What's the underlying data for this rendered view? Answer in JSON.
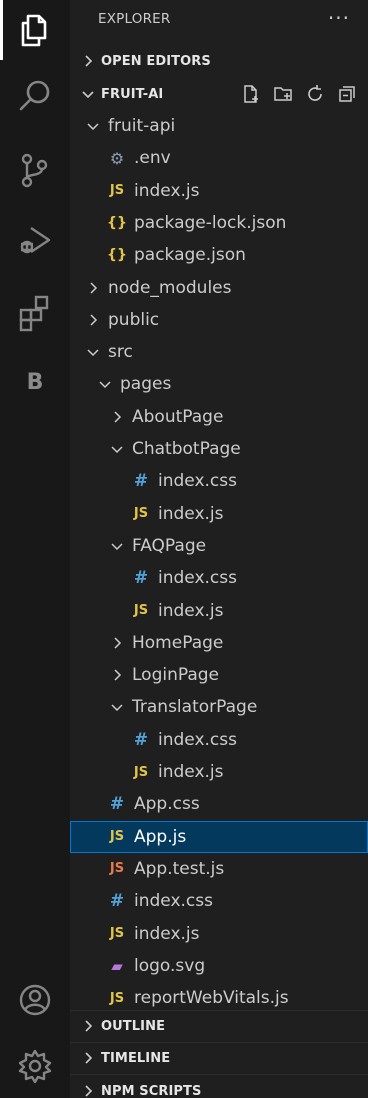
{
  "activity_bar": {
    "items": [
      {
        "name": "explorer-icon"
      },
      {
        "name": "search-icon"
      },
      {
        "name": "source-control-icon"
      },
      {
        "name": "run-debug-icon"
      },
      {
        "name": "extensions-icon"
      },
      {
        "name": "b-extension-icon",
        "label": "B"
      }
    ],
    "bottom": [
      {
        "name": "account-icon"
      },
      {
        "name": "settings-gear-icon"
      }
    ]
  },
  "explorer": {
    "title": "EXPLORER",
    "more": "···",
    "open_editors": "OPEN EDITORS",
    "project": "FRUIT-AI",
    "outline": "OUTLINE",
    "timeline": "TIMELINE",
    "npm_scripts": "NPM SCRIPTS"
  },
  "tree": [
    {
      "label": "fruit-api",
      "type": "folder",
      "expanded": true
    },
    {
      "label": ".env",
      "type": "env"
    },
    {
      "label": "index.js",
      "type": "js"
    },
    {
      "label": "package-lock.json",
      "type": "json"
    },
    {
      "label": "package.json",
      "type": "json"
    },
    {
      "label": "node_modules",
      "type": "folder",
      "expanded": false
    },
    {
      "label": "public",
      "type": "folder",
      "expanded": false
    },
    {
      "label": "src",
      "type": "folder",
      "expanded": true
    },
    {
      "label": "pages",
      "type": "folder",
      "expanded": true
    },
    {
      "label": "AboutPage",
      "type": "folder",
      "expanded": false
    },
    {
      "label": "ChatbotPage",
      "type": "folder",
      "expanded": true
    },
    {
      "label": "index.css",
      "type": "css"
    },
    {
      "label": "index.js",
      "type": "js"
    },
    {
      "label": "FAQPage",
      "type": "folder",
      "expanded": true
    },
    {
      "label": "index.css",
      "type": "css"
    },
    {
      "label": "index.js",
      "type": "js"
    },
    {
      "label": "HomePage",
      "type": "folder",
      "expanded": false
    },
    {
      "label": "LoginPage",
      "type": "folder",
      "expanded": false
    },
    {
      "label": "TranslatorPage",
      "type": "folder",
      "expanded": true
    },
    {
      "label": "index.css",
      "type": "css"
    },
    {
      "label": "index.js",
      "type": "js"
    },
    {
      "label": "App.css",
      "type": "css"
    },
    {
      "label": "App.js",
      "type": "js",
      "selected": true
    },
    {
      "label": "App.test.js",
      "type": "js-test"
    },
    {
      "label": "index.css",
      "type": "css"
    },
    {
      "label": "index.js",
      "type": "js"
    },
    {
      "label": "logo.svg",
      "type": "svg"
    },
    {
      "label": "reportWebVitals.js",
      "type": "js"
    }
  ],
  "icon_glyphs": {
    "js": "JS",
    "js-test": "JS",
    "css": "#",
    "json": "{}",
    "env": "⚙",
    "svg": "▰"
  },
  "colors": {
    "selected_bg": "#04395e",
    "selected_border": "#0078d4",
    "js": "#e3c349",
    "css": "#4fa3d9",
    "test_js": "#e8794a",
    "svg": "#b877db"
  }
}
